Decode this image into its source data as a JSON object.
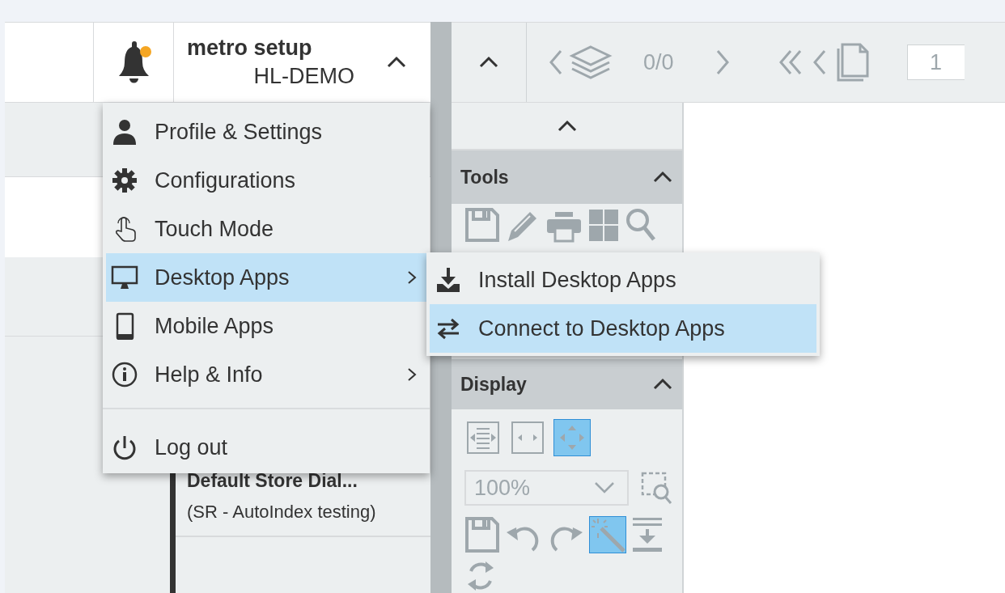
{
  "header": {
    "has_notifications": true,
    "user": {
      "name": "metro setup",
      "tenant": "HL-DEMO",
      "expanded": true
    }
  },
  "toolbar": {
    "expanded": true,
    "page_counter": "0/0",
    "page_input": "1"
  },
  "documents": [
    {
      "title": "Default Store Dial...",
      "subtitle": "(SR - AutoIndex testing)"
    }
  ],
  "side_panel": {
    "tools": {
      "title": "Tools",
      "expanded": true
    },
    "display": {
      "title": "Display",
      "expanded": true,
      "zoom": "100%",
      "fit_buttons": [
        {
          "kind": "fit-page",
          "selected": false
        },
        {
          "kind": "fit-width",
          "selected": false
        },
        {
          "kind": "fit-all",
          "selected": true
        }
      ],
      "auto_enhance_on": true
    }
  },
  "user_menu": {
    "items": [
      {
        "kind": "profile",
        "label": "Profile & Settings",
        "has_submenu": false,
        "selected": false
      },
      {
        "kind": "config",
        "label": "Configurations",
        "has_submenu": false,
        "selected": false
      },
      {
        "kind": "touch",
        "label": "Touch Mode",
        "has_submenu": false,
        "selected": false
      },
      {
        "kind": "desktop",
        "label": "Desktop Apps",
        "has_submenu": true,
        "selected": true
      },
      {
        "kind": "mobile",
        "label": "Mobile Apps",
        "has_submenu": false,
        "selected": false
      },
      {
        "kind": "help",
        "label": "Help & Info",
        "has_submenu": true,
        "selected": false
      }
    ],
    "footer_items": [
      {
        "kind": "logout",
        "label": "Log out",
        "has_submenu": false,
        "selected": false
      }
    ]
  },
  "submenu": {
    "items": [
      {
        "kind": "install",
        "label": "Install Desktop Apps",
        "has_submenu": false,
        "selected": false
      },
      {
        "kind": "connect",
        "label": "Connect to Desktop Apps",
        "has_submenu": false,
        "selected": true
      }
    ]
  }
}
